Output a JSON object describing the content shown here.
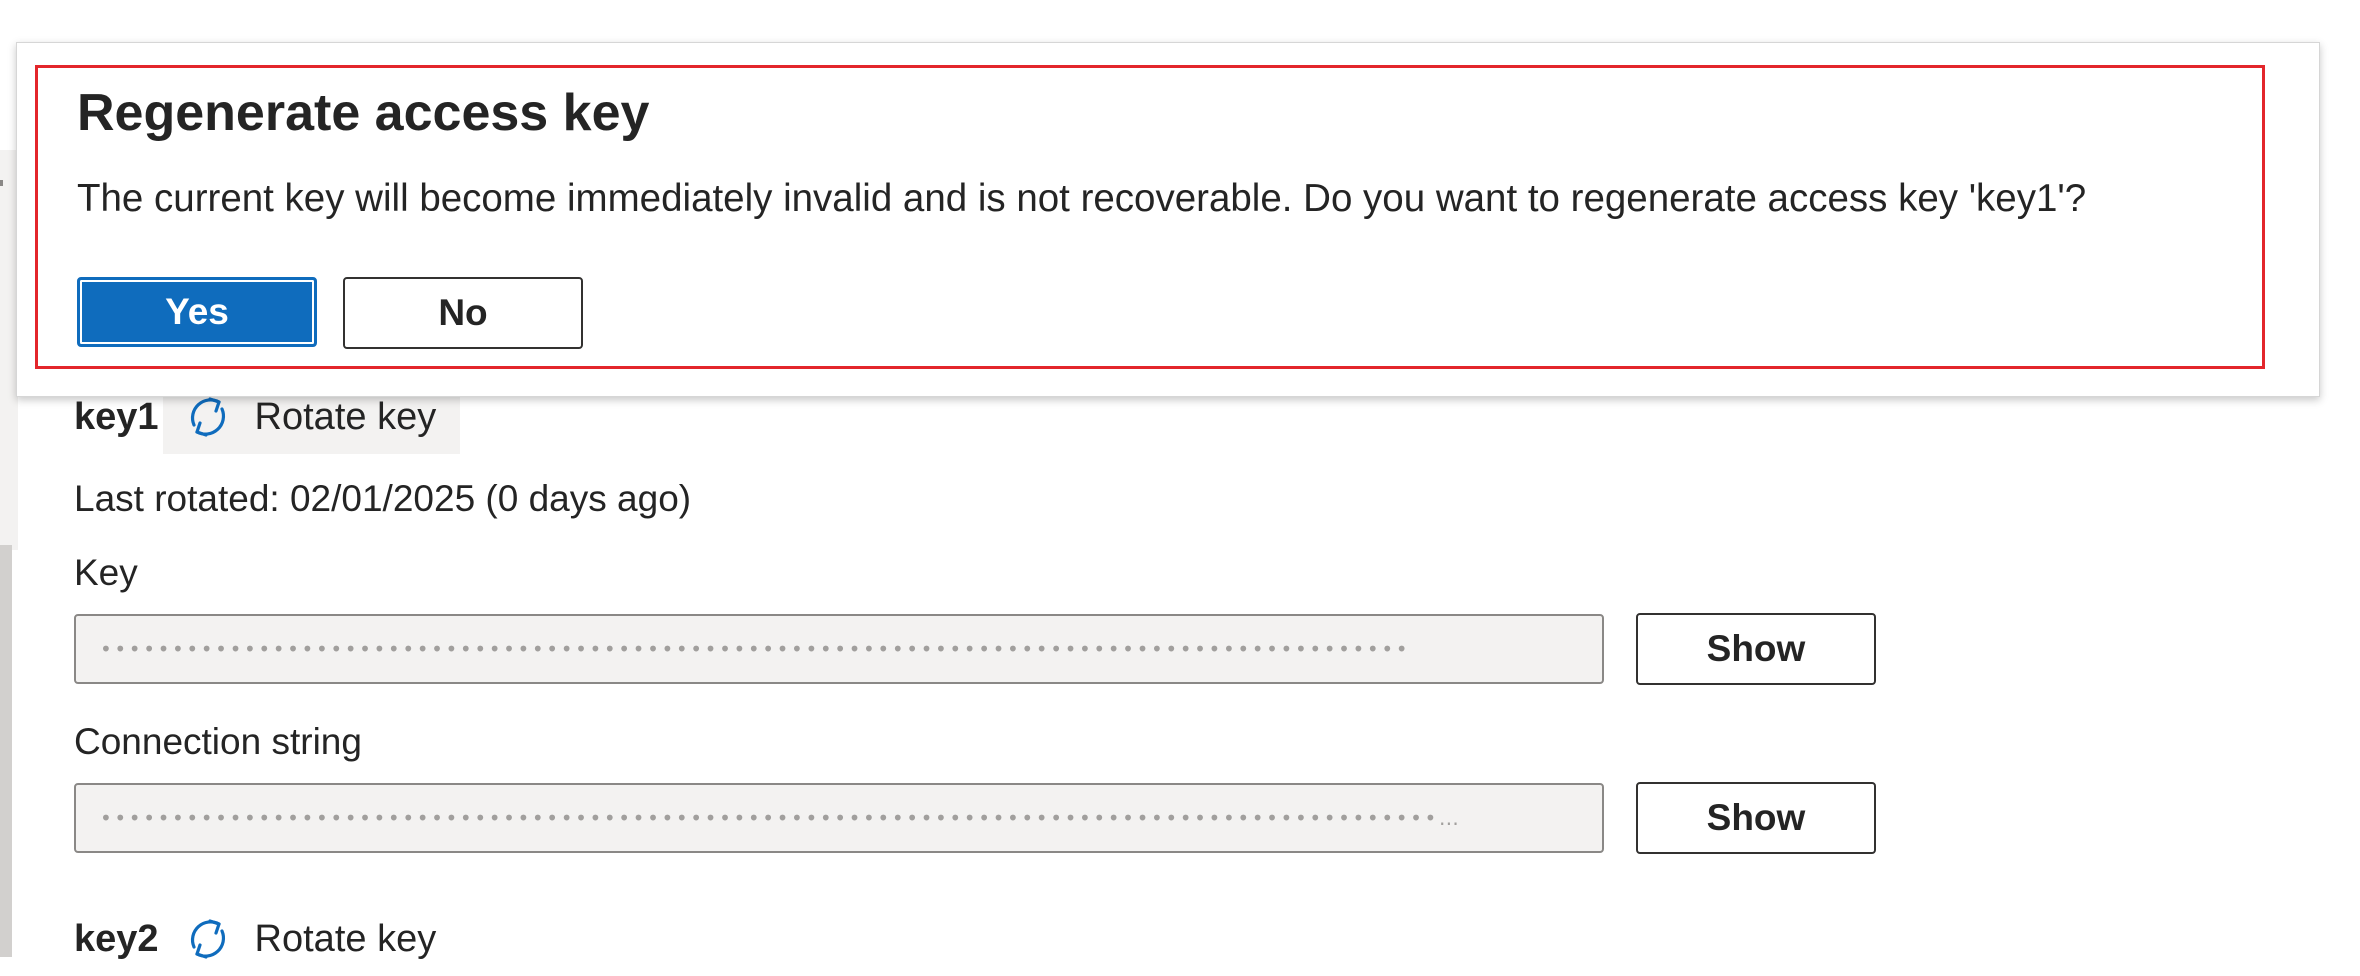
{
  "dialog": {
    "title": "Regenerate access key",
    "message": "The current key will become immediately invalid and is not recoverable. Do you want to regenerate access key 'key1'?",
    "yes_label": "Yes",
    "no_label": "No"
  },
  "key1": {
    "name": "key1",
    "rotate_label": "Rotate key",
    "last_rotated": "Last rotated: 02/01/2025 (0 days ago)",
    "key_label": "Key",
    "key_value": "•••••••••••••••••••••••••••••••••••••••••••••••••••••••••••••••••••••••••••••••••••••••••••",
    "key_show_label": "Show",
    "connection_label": "Connection string",
    "connection_value": "•••••••••••••••••••••••••••••••••••••••••••••••••••••••••••••••••••••••••••••••••••••••••••••…",
    "connection_show_label": "Show"
  },
  "key2": {
    "name": "key2",
    "rotate_label": "Rotate key"
  },
  "colors": {
    "accent": "#0f6cbd",
    "highlight_frame": "#e3262b",
    "input_bg": "#f3f2f1"
  },
  "icons": {
    "rotate": "rotate-icon"
  }
}
